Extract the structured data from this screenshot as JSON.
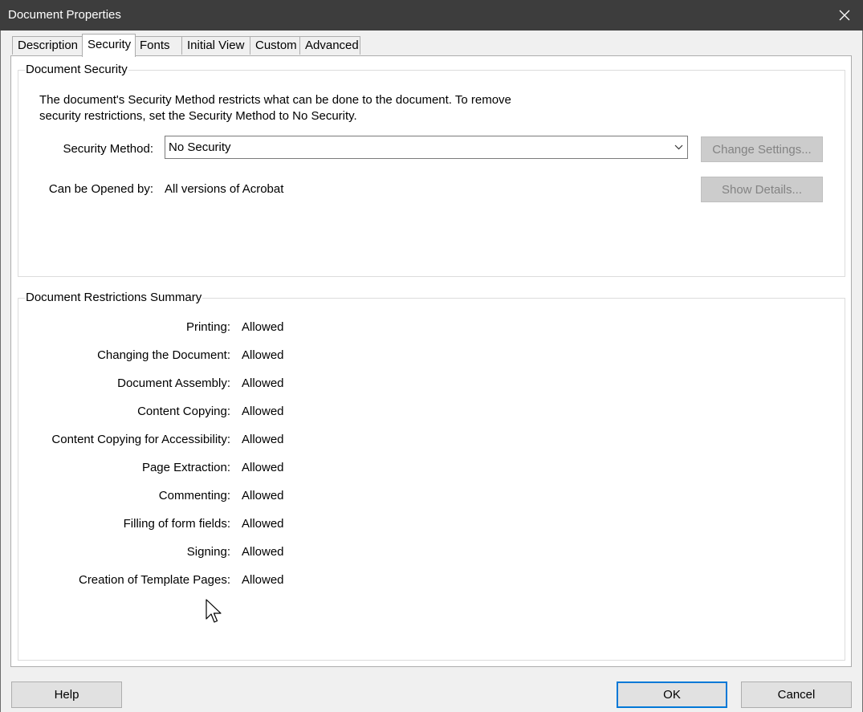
{
  "window": {
    "title": "Document Properties"
  },
  "tabs": [
    {
      "label": "Description"
    },
    {
      "label": "Security",
      "active": true
    },
    {
      "label": "Fonts"
    },
    {
      "label": "Initial View"
    },
    {
      "label": "Custom"
    },
    {
      "label": "Advanced"
    }
  ],
  "security_group": {
    "title": "Document Security",
    "description_line1": "The document's Security Method restricts what can be done to the document. To remove",
    "description_line2": "security restrictions, set the Security Method to No Security.",
    "method_label": "Security Method:",
    "method_value": "No Security",
    "change_settings_label": "Change Settings...",
    "opened_by_label": "Can be Opened by:",
    "opened_by_value": "All versions of Acrobat",
    "show_details_label": "Show Details..."
  },
  "restrictions_group": {
    "title": "Document Restrictions Summary",
    "rows": [
      {
        "label": "Printing:",
        "value": "Allowed"
      },
      {
        "label": "Changing the Document:",
        "value": "Allowed"
      },
      {
        "label": "Document Assembly:",
        "value": "Allowed"
      },
      {
        "label": "Content Copying:",
        "value": "Allowed"
      },
      {
        "label": "Content Copying for Accessibility:",
        "value": "Allowed"
      },
      {
        "label": "Page Extraction:",
        "value": "Allowed"
      },
      {
        "label": "Commenting:",
        "value": "Allowed"
      },
      {
        "label": "Filling of form fields:",
        "value": "Allowed"
      },
      {
        "label": "Signing:",
        "value": "Allowed"
      },
      {
        "label": "Creation of Template Pages:",
        "value": "Allowed"
      }
    ]
  },
  "footer": {
    "help_label": "Help",
    "ok_label": "OK",
    "cancel_label": "Cancel"
  },
  "colors": {
    "titlebar": "#3d3d3d",
    "dialog_bg": "#f0f0f0",
    "panel_bg": "#ffffff",
    "default_button_border": "#0078d7",
    "disabled_text": "#838383"
  },
  "icons": {
    "close": "close-icon",
    "dropdown": "chevron-down-icon",
    "cursor": "mouse-pointer-icon"
  }
}
